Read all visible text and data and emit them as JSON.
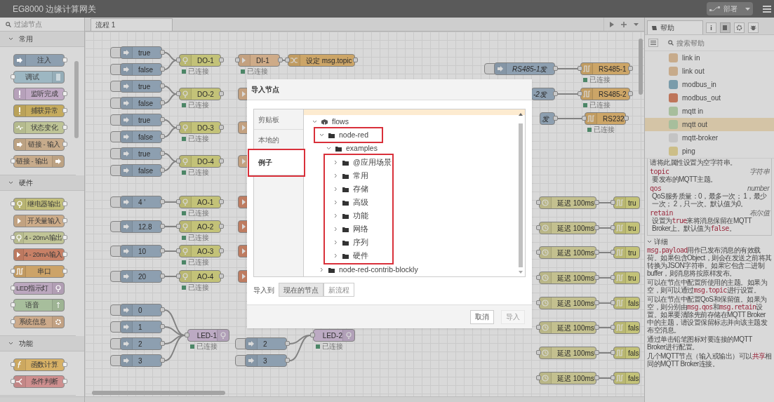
{
  "header": {
    "title": "EG8000 边缘计算网关",
    "deploy_label": "部署"
  },
  "palette": {
    "filter_placeholder": "过滤节点",
    "categories": [
      {
        "label": "常用",
        "expanded": true,
        "nodes": [
          {
            "label": "注入",
            "kind": "inject",
            "color": "#8d9fb0",
            "icon_right": false,
            "has_input": false,
            "has_output": true
          },
          {
            "label": "调试",
            "kind": "debug",
            "color": "#9db7c2",
            "icon_right": true,
            "has_input": true,
            "has_output": false
          },
          {
            "label": "监听完成",
            "kind": "complete",
            "color": "#c0aac4",
            "icon_right": false,
            "has_input": false,
            "has_output": true
          },
          {
            "label": "捕获异常",
            "kind": "catch",
            "color": "#c5ab5e",
            "icon_right": false,
            "has_input": false,
            "has_output": true
          },
          {
            "label": "状态变化",
            "kind": "status",
            "color": "#bec496",
            "icon_right": false,
            "has_input": false,
            "has_output": true
          },
          {
            "label": "链接 - 输入",
            "kind": "link_in",
            "color": "#c7ab8b",
            "icon_right": false,
            "has_input": false,
            "has_output": true
          },
          {
            "label": "链接 - 输出",
            "kind": "link_out",
            "color": "#c7ab8b",
            "icon_right": true,
            "has_input": true,
            "has_output": false
          }
        ]
      },
      {
        "label": "硬件",
        "expanded": true,
        "nodes": [
          {
            "label": "继电器输出",
            "kind": "relay",
            "color": "#c2be7a",
            "icon_right": false,
            "has_input": true,
            "has_output": true
          },
          {
            "label": "开关量输入",
            "kind": "di",
            "color": "#ccab88",
            "icon_right": false,
            "has_input": false,
            "has_output": true
          },
          {
            "label": "4 - 20mA输出",
            "kind": "ao",
            "color": "#c0c496",
            "icon_right": false,
            "has_input": true,
            "has_output": true
          },
          {
            "label": "4 - 20mA输入",
            "kind": "ai",
            "color": "#c78066",
            "icon_right": false,
            "has_input": false,
            "has_output": true
          },
          {
            "label": "串口",
            "kind": "serial",
            "color": "#cca368",
            "icon_right": false,
            "has_input": true,
            "has_output": true
          },
          {
            "label": "LED指示灯",
            "kind": "led",
            "color": "#bba7be",
            "icon_right": true,
            "has_input": true,
            "has_output": false
          },
          {
            "label": "语音",
            "kind": "voice",
            "color": "#a7be9c",
            "icon_right": true,
            "has_input": true,
            "has_output": false
          },
          {
            "label": "系统信息",
            "kind": "sysinfo",
            "color": "#ccaa8b",
            "icon_right": true,
            "has_input": true,
            "has_output": false
          }
        ]
      },
      {
        "label": "功能",
        "expanded": true,
        "nodes": [
          {
            "label": "函数计算",
            "kind": "function",
            "color": "#d7b166",
            "icon_right": false,
            "has_input": true,
            "has_output": true
          },
          {
            "label": "条件判断",
            "kind": "switch",
            "color": "#ce8f8f",
            "icon_right": false,
            "has_input": true,
            "has_output": true
          }
        ]
      }
    ]
  },
  "canvas": {
    "tab_label": "流程 1",
    "nodes": [
      {
        "kind": "inject",
        "label": "true"
      },
      {
        "kind": "inject",
        "label": "false"
      },
      {
        "kind": "inject",
        "label": "true"
      },
      {
        "kind": "inject",
        "label": "false"
      },
      {
        "kind": "inject",
        "label": "true"
      },
      {
        "kind": "inject",
        "label": "false"
      },
      {
        "kind": "inject",
        "label": "true"
      },
      {
        "kind": "inject",
        "label": "false"
      },
      {
        "kind": "do",
        "label": "DO-1",
        "status": "已连接"
      },
      {
        "kind": "do",
        "label": "DO-2",
        "status": "已连接"
      },
      {
        "kind": "do",
        "label": "DO-3",
        "status": "已连接"
      },
      {
        "kind": "do",
        "label": "DO-4",
        "status": "已连接"
      },
      {
        "kind": "di",
        "label": "DI-1",
        "status": "已连接"
      },
      {
        "kind": "change",
        "label": "设定 msg.topic"
      },
      {
        "kind": "di"
      },
      {
        "kind": "di"
      },
      {
        "kind": "di"
      },
      {
        "kind": "inject",
        "label": "4 '"
      },
      {
        "kind": "inject",
        "label": "12.8"
      },
      {
        "kind": "inject",
        "label": "10"
      },
      {
        "kind": "inject",
        "label": "20"
      },
      {
        "kind": "do",
        "label": "AO-1",
        "status": "已连接"
      },
      {
        "kind": "do",
        "label": "AO-2",
        "status": "已连接"
      },
      {
        "kind": "do",
        "label": "AO-3",
        "status": "已连接"
      },
      {
        "kind": "do",
        "label": "AO-4",
        "status": "已连接"
      },
      {
        "kind": "ai"
      },
      {
        "kind": "ai"
      },
      {
        "kind": "ai"
      },
      {
        "kind": "ai"
      },
      {
        "kind": "inject",
        "label": "0"
      },
      {
        "kind": "inject",
        "label": "1"
      },
      {
        "kind": "inject",
        "label": "2"
      },
      {
        "kind": "inject",
        "label": "3"
      },
      {
        "kind": "led",
        "label": "LED-1",
        "status": "已连接"
      },
      {
        "kind": "inject",
        "label": "2"
      },
      {
        "kind": "inject",
        "label": "3"
      },
      {
        "kind": "led",
        "label": "LED-2",
        "status": "已连接"
      },
      {
        "kind": "inject",
        "label": "RS485-1发",
        "italic": true
      },
      {
        "kind": "serial",
        "label": "RS485-1",
        "status": "已连接"
      },
      {
        "kind": "inject",
        "label": "-2发",
        "italic": true
      },
      {
        "kind": "serial",
        "label": "RS485-2",
        "status": "已连接"
      },
      {
        "kind": "inject",
        "label": "发",
        "italic": true
      },
      {
        "kind": "serial",
        "label": "RS232",
        "status": "已连接"
      },
      {
        "kind": "delay",
        "label": "延迟 100ms"
      },
      {
        "kind": "delay",
        "label": "延迟 100ms"
      },
      {
        "kind": "delay",
        "label": "延迟 100ms"
      },
      {
        "kind": "delay",
        "label": "延迟 100ms"
      },
      {
        "kind": "delay",
        "label": "延迟 100ms"
      },
      {
        "kind": "delay",
        "label": "延迟 100ms"
      },
      {
        "kind": "delay",
        "label": "延迟 100ms"
      },
      {
        "kind": "delay",
        "label": "延迟 100ms"
      },
      {
        "kind": "serial_out",
        "label": "tru"
      },
      {
        "kind": "serial_out",
        "label": "tru"
      },
      {
        "kind": "serial_out",
        "label": "tru"
      },
      {
        "kind": "serial_out",
        "label": "tru"
      },
      {
        "kind": "serial_out",
        "label": "fals"
      },
      {
        "kind": "serial_out",
        "label": "fals"
      },
      {
        "kind": "serial_out",
        "label": "fals"
      },
      {
        "kind": "serial_out",
        "label": "fals"
      }
    ]
  },
  "sidebar": {
    "tab_label": "帮助",
    "search_placeholder": "搜索帮助",
    "node_list": [
      {
        "label": "link in",
        "color": "#c7ab8b",
        "selected": false
      },
      {
        "label": "link out",
        "color": "#c7ab8b",
        "selected": false
      },
      {
        "label": "modbus_in",
        "color": "#7a9cab",
        "selected": false
      },
      {
        "label": "modbus_out",
        "color": "#be755a",
        "selected": false
      },
      {
        "label": "mqtt in",
        "color": "#a7be9c",
        "selected": false
      },
      {
        "label": "mqtt out",
        "color": "#a7be9c",
        "selected": true
      },
      {
        "label": "mqtt-broker",
        "color": "#c4c4c4",
        "selected": false
      },
      {
        "label": "ping",
        "color": "#ccbe88",
        "selected": false
      }
    ],
    "properties_intro": "请将此属性设置为空字符串。",
    "properties": [
      {
        "name": "topic",
        "type": "字符串",
        "description": [
          {
            "text": "要发布的MQTT主题。",
            "code": false
          }
        ]
      },
      {
        "name": "qos",
        "type": "number",
        "description": [
          {
            "text": "QoS服务质量：0，最多一次； 1，最少一次； 2，只一次。默认值为0。",
            "code": false
          }
        ]
      },
      {
        "name": "retain",
        "type": "布尔值",
        "description": [
          {
            "text": "设置为",
            "code": false
          },
          {
            "text": "true",
            "code": true
          },
          {
            "text": "来将消息保留在MQTT Broker上。默认值为",
            "code": false
          },
          {
            "text": "false",
            "code": true
          },
          {
            "text": "。",
            "code": false
          }
        ]
      }
    ],
    "details_heading": "详细",
    "details_expanded": true,
    "paragraphs": [
      [
        {
          "text": "msg.payload",
          "code": true
        },
        {
          "text": "用作已发布消息的有效载荷。如果包含Object，则会在发送之前将其转换为JSON字符串。如果它包含二进制buffer，则消息将按原样发布。",
          "code": false
        }
      ],
      [
        {
          "text": "可以在节点中配置所使用的主题。如果为空，则可以通过",
          "code": false
        },
        {
          "text": "msg.topic",
          "code": true
        },
        {
          "text": "进行设置。",
          "code": false
        }
      ],
      [
        {
          "text": "可以在节点中配置QoS和保留值。如果为空，则分别由",
          "code": false
        },
        {
          "text": "msg.qos",
          "code": true
        },
        {
          "text": "和",
          "code": false
        },
        {
          "text": "msg.retain",
          "code": true
        },
        {
          "text": "设置。如果要清除先前存储在MQTT Broker中的主题，请设置保留标志并向该主题发布空消息。",
          "code": false
        }
      ],
      [
        {
          "text": "通过单击铅笔图标对要连接的MQTT Broker进行配置。",
          "code": false
        }
      ],
      [
        {
          "text": "几个MQTT节点（输入或输出）可以",
          "code": false
        },
        {
          "text": "共享",
          "code": true
        },
        {
          "text": "相同的MQTT Broker连接。",
          "code": false
        }
      ]
    ]
  },
  "dialog": {
    "title": "导入节点",
    "tabs": [
      {
        "label": "剪贴板",
        "selected": false,
        "annotated": false
      },
      {
        "label": "本地的",
        "selected": false,
        "annotated": false
      },
      {
        "label": "例子",
        "selected": true,
        "annotated": true
      }
    ],
    "tree": [
      {
        "label": "flows",
        "kind": "package",
        "expanded": true,
        "children": [
          {
            "label": "node-red",
            "kind": "folder",
            "expanded": true,
            "annotated": true,
            "children": [
              {
                "label": "examples",
                "kind": "folder",
                "expanded": true,
                "children_annotated": true,
                "children": [
                  {
                    "label": "@应用场景",
                    "kind": "folder",
                    "expanded": false
                  },
                  {
                    "label": "常用",
                    "kind": "folder",
                    "expanded": false
                  },
                  {
                    "label": "存储",
                    "kind": "folder",
                    "expanded": false
                  },
                  {
                    "label": "高级",
                    "kind": "folder",
                    "expanded": false
                  },
                  {
                    "label": "功能",
                    "kind": "folder",
                    "expanded": false
                  },
                  {
                    "label": "网络",
                    "kind": "folder",
                    "expanded": false
                  },
                  {
                    "label": "序列",
                    "kind": "folder",
                    "expanded": false
                  },
                  {
                    "label": "硬件",
                    "kind": "folder",
                    "expanded": false
                  }
                ]
              }
            ]
          },
          {
            "label": "node-red-contrib-blockly",
            "kind": "folder",
            "expanded": false
          }
        ]
      }
    ],
    "import_to_label": "导入到",
    "import_targets": [
      {
        "label": "现在的节点",
        "selected": true
      },
      {
        "label": "新流程",
        "selected": false
      }
    ],
    "buttons": [
      {
        "label": "取消",
        "disabled": false
      },
      {
        "label": "导入",
        "disabled": true
      }
    ]
  }
}
